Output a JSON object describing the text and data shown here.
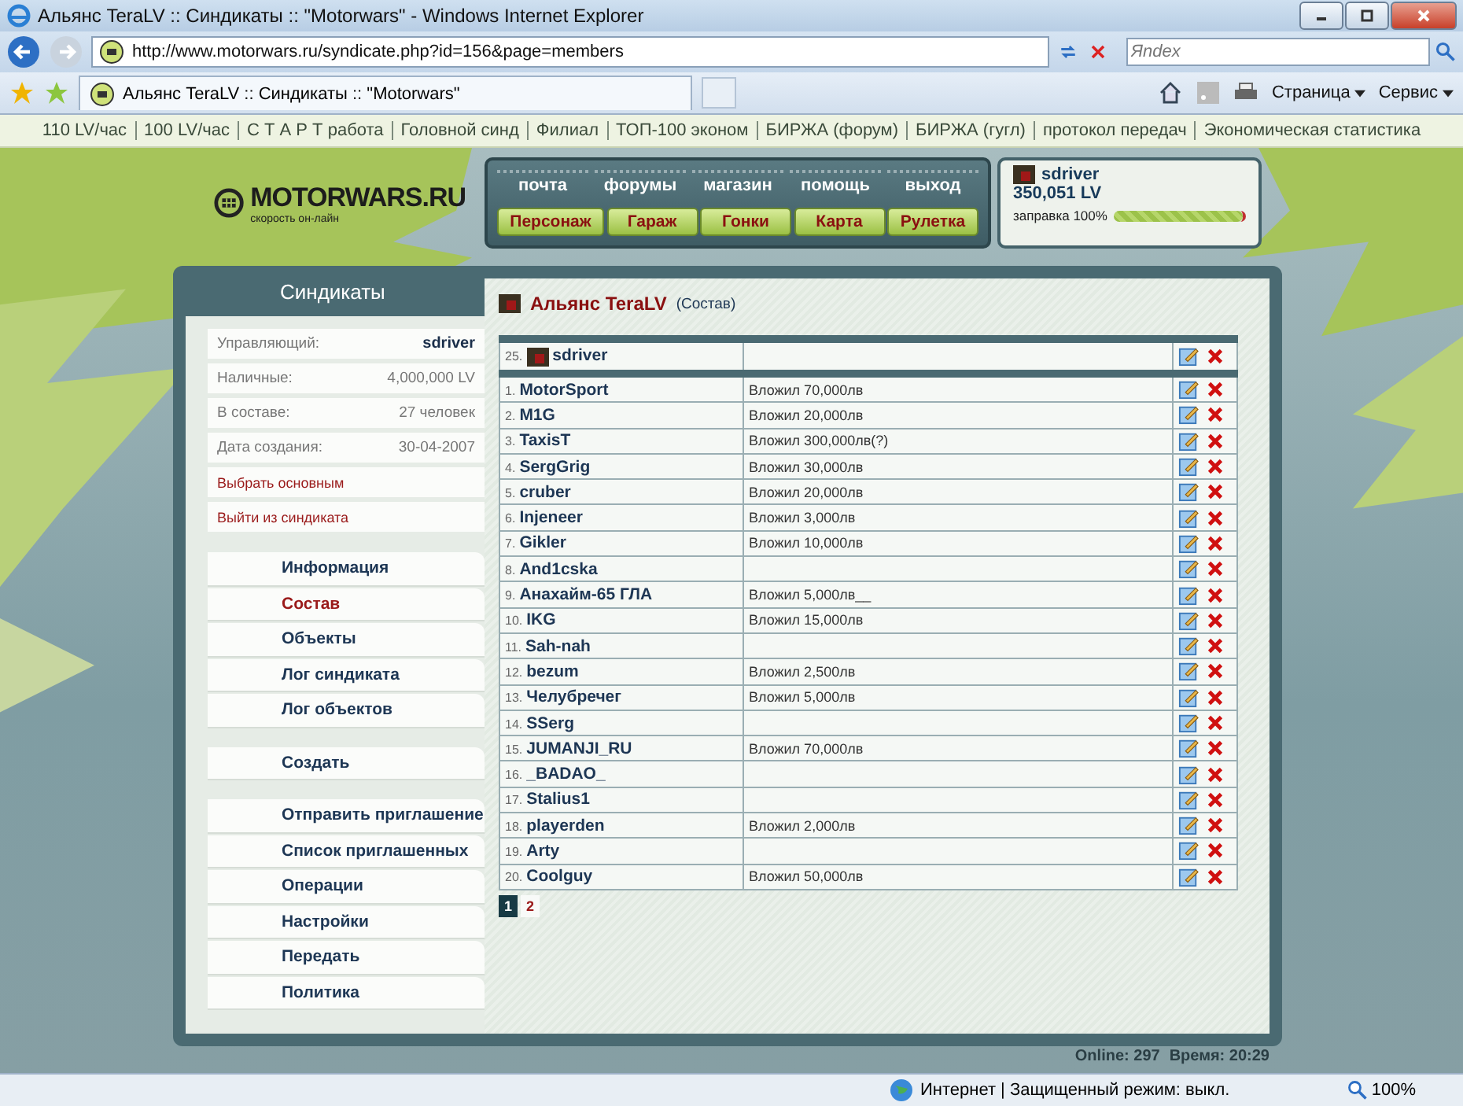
{
  "window": {
    "title": "Альянс TeraLV :: Синдикаты :: \"Motorwars\" - Windows Internet Explorer"
  },
  "browser": {
    "url": "http://www.motorwars.ru/syndicate.php?id=156&page=members",
    "search_placeholder": "Яndex",
    "tab_title": "Альянс TeraLV :: Синдикаты :: \"Motorwars\"",
    "commands": [
      "Страница",
      "Сервис"
    ]
  },
  "top_links": [
    "110 LV/час",
    "100 LV/час",
    "С Т А Р Т работа",
    "Головной синд",
    "Филиал",
    "ТОП-100 эконом",
    "БИРЖА (форум)",
    "БИРЖА (гугл)",
    "протокол передач",
    "Экономическая статистика"
  ],
  "logo": {
    "name": "MOTORWARS.RU",
    "tagline": "скорость он-лайн"
  },
  "nav": {
    "links": [
      "почта",
      "форумы",
      "магазин",
      "помощь",
      "выход"
    ],
    "buttons": [
      "Персонаж",
      "Гараж",
      "Гонки",
      "Карта",
      "Рулетка"
    ]
  },
  "user": {
    "name": "sdriver",
    "money": "350,051 LV",
    "fuel": {
      "label": "заправка 100%",
      "level": 1
    }
  },
  "sidebar": {
    "title": "Синдикаты",
    "info": [
      {
        "label": "Управляющий:",
        "value": "sdriver",
        "strong": true
      },
      {
        "label": "Наличные:",
        "value": "4,000,000 LV",
        "strong": false
      },
      {
        "label": "В составе:",
        "value": "27 человек",
        "strong": false
      },
      {
        "label": "Дата создания:",
        "value": "30-04-2007",
        "strong": false
      }
    ],
    "actions": [
      "Выбрать основным",
      "Выйти из синдиката"
    ],
    "menu_groups": [
      [
        {
          "label": "Информация",
          "selected": false
        },
        {
          "label": "Состав",
          "selected": true
        },
        {
          "label": "Объекты",
          "selected": false
        },
        {
          "label": "Лог синдиката",
          "selected": false
        },
        {
          "label": "Лог объектов",
          "selected": false
        }
      ],
      [
        {
          "label": "Создать",
          "selected": false
        }
      ],
      [
        {
          "label": "Отправить приглашение",
          "selected": false
        },
        {
          "label": "Список приглашенных",
          "selected": false
        },
        {
          "label": "Операции",
          "selected": false
        },
        {
          "label": "Настройки",
          "selected": false
        },
        {
          "label": "Передать",
          "selected": false
        },
        {
          "label": "Политика",
          "selected": false
        }
      ]
    ]
  },
  "content": {
    "title": "Альянс TeraLV",
    "subtitle": "(Состав)",
    "leader": {
      "number": "25.",
      "name": "sdriver"
    },
    "members": [
      {
        "number": "1.",
        "name": "MotorSport",
        "note": "Вложил 70,000лв"
      },
      {
        "number": "2.",
        "name": "M1G",
        "note": "Вложил 20,000лв"
      },
      {
        "number": "3.",
        "name": "TaxisT",
        "note": "Вложил 300,000лв(?)"
      },
      {
        "number": "4.",
        "name": "SergGrig",
        "note": "Вложил 30,000лв"
      },
      {
        "number": "5.",
        "name": "cruber",
        "note": "Вложил 20,000лв"
      },
      {
        "number": "6.",
        "name": "Injeneer",
        "note": "Вложил 3,000лв"
      },
      {
        "number": "7.",
        "name": "Gikler",
        "note": "Вложил 10,000лв"
      },
      {
        "number": "8.",
        "name": "And1cska"
      },
      {
        "number": "9.",
        "name": "Анахайм-65 ГЛА",
        "note": "Вложил 5,000лв__"
      },
      {
        "number": "10.",
        "name": "IKG",
        "note": "Вложил 15,000лв"
      },
      {
        "number": "11.",
        "name": "Sah-nah"
      },
      {
        "number": "12.",
        "name": "bezum",
        "note": "Вложил 2,500лв"
      },
      {
        "number": "13.",
        "name": "Челубречег",
        "note": "Вложил 5,000лв"
      },
      {
        "number": "14.",
        "name": "SSerg"
      },
      {
        "number": "15.",
        "name": "JUMANJI_RU",
        "note": "Вложил 70,000лв"
      },
      {
        "number": "16.",
        "name": "_BADAO_"
      },
      {
        "number": "17.",
        "name": "Stalius1"
      },
      {
        "number": "18.",
        "name": "playerden",
        "note": "Вложил 2,000лв"
      },
      {
        "number": "19.",
        "name": "Arty"
      },
      {
        "number": "20.",
        "name": "Coolguy",
        "note": "Вложил 50,000лв"
      }
    ],
    "pages": [
      {
        "label": "1",
        "selected": true
      },
      {
        "label": "2",
        "selected": false
      }
    ]
  },
  "footer": {
    "online": "Online: 297",
    "time": "Время: 20:29"
  },
  "status_bar": {
    "zone": "Интернет | Защищенный режим: выкл.",
    "zoom": "100%"
  }
}
